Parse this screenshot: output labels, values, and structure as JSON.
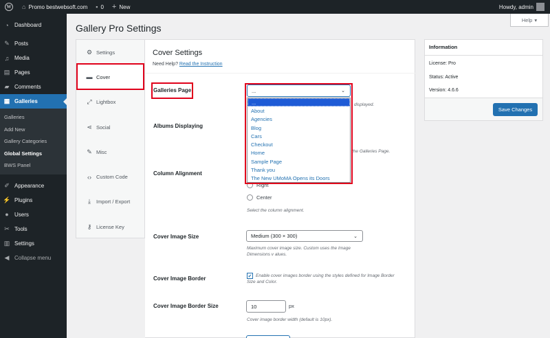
{
  "adminbar": {
    "site_name": "Promo bestwebsoft.com",
    "comments_count": "0",
    "new_label": "New",
    "howdy": "Howdy, admin"
  },
  "sidebar": {
    "items": [
      {
        "label": "Dashboard",
        "icon": "dashboard-icon"
      },
      {
        "label": "Posts",
        "icon": "pin-icon"
      },
      {
        "label": "Media",
        "icon": "media-icon"
      },
      {
        "label": "Pages",
        "icon": "pages-icon"
      },
      {
        "label": "Comments",
        "icon": "comments-icon"
      },
      {
        "label": "Galleries",
        "icon": "galleries-icon"
      },
      {
        "label": "Appearance",
        "icon": "brush-icon"
      },
      {
        "label": "Plugins",
        "icon": "plugin-icon"
      },
      {
        "label": "Users",
        "icon": "users-icon"
      },
      {
        "label": "Tools",
        "icon": "wrench-icon"
      },
      {
        "label": "Settings",
        "icon": "settings-icon"
      },
      {
        "label": "Collapse menu",
        "icon": "collapse-icon"
      }
    ],
    "submenu": [
      "Galleries",
      "Add New",
      "Gallery Categories",
      "Global Settings",
      "BWS Panel"
    ]
  },
  "help_label": "Help",
  "page_title": "Gallery Pro Settings",
  "tabs": [
    {
      "label": "Settings"
    },
    {
      "label": "Cover"
    },
    {
      "label": "Lightbox"
    },
    {
      "label": "Social"
    },
    {
      "label": "Misc"
    },
    {
      "label": "Custom Code"
    },
    {
      "label": "Import / Export"
    },
    {
      "label": "License Key"
    }
  ],
  "section": {
    "title": "Cover Settings",
    "need_help": "Need Help?",
    "instruction_link": "Read the Instruction"
  },
  "fields": {
    "galleries_page": {
      "label": "Galleries Page",
      "value": "...",
      "desc_tail": "displayed."
    },
    "albums_displaying": {
      "label": "Albums Displaying",
      "desc_tail": "the Galleries Page."
    },
    "column_alignment": {
      "label": "Column Alignment",
      "options": [
        "Right",
        "Center"
      ],
      "desc": "Select the column alignment."
    },
    "cover_image_size": {
      "label": "Cover Image Size",
      "value": "Medium (300 × 300)",
      "desc": "Maximum cover image size. Custom uses the Image Dimensions v alues."
    },
    "cover_image_border": {
      "label": "Cover Image Border",
      "checkbox_label": "Enable cover images border using the styles defined for Image Border Size and Color."
    },
    "cover_image_border_size": {
      "label": "Cover Image Border Size",
      "value": "10",
      "unit": "px",
      "desc": "Cover image border width (default is 10px)."
    }
  },
  "dropdown_options": [
    "...",
    "About",
    "Agencies",
    "Blog",
    "Cars",
    "Checkout",
    "Home",
    "Sample Page",
    "Thank you",
    "The New UMoMA Opens its Doors"
  ],
  "info": {
    "title": "Information",
    "license": "License: Pro",
    "status": "Status: Active",
    "version": "Version: 4.6.6",
    "save_label": "Save Changes"
  }
}
